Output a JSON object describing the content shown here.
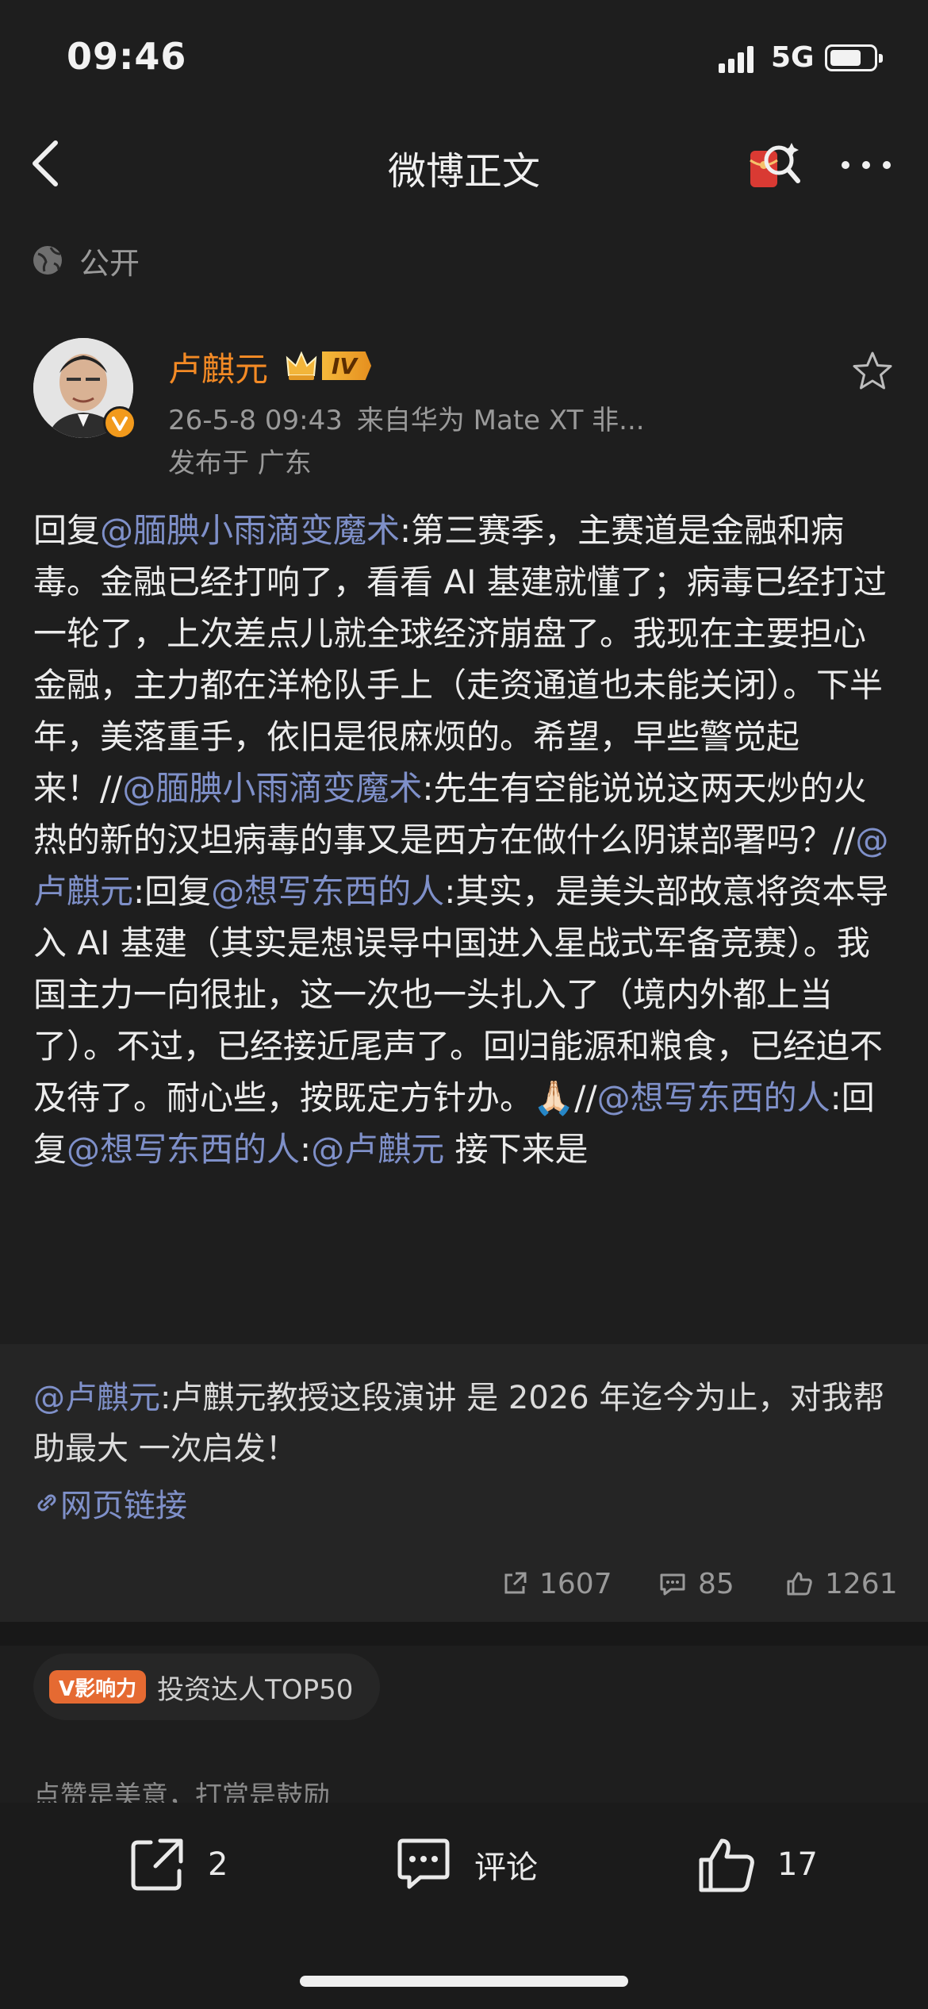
{
  "status_bar": {
    "time": "09:46",
    "network": "5G"
  },
  "nav": {
    "title": "微博正文"
  },
  "visibility": {
    "label": "公开"
  },
  "post": {
    "author": "卢麒元",
    "level_badge": "IV",
    "timestamp": "26-5-8 09:43",
    "source": "来自华为 Mate XT 非...",
    "location": "发布于 广东",
    "body": [
      {
        "t": "回复"
      },
      {
        "t": "@腼腆小雨滴变魔术",
        "m": true
      },
      {
        "t": ":第三赛季，主赛道是金融和病毒。金融已经打响了，看看 AI 基建就懂了；病毒已经打过一轮了，上次差点儿就全球经济崩盘了。我现在主要担心金融，主力都在洋枪队手上（走资通道也未能关闭）。下半年，美落重手，依旧是很麻烦的。希望，早些警觉起来！//"
      },
      {
        "t": "@腼腆小雨滴变魔术",
        "m": true
      },
      {
        "t": ":先生有空能说说这两天炒的火热的新的汉坦病毒的事又是西方在做什么阴谋部署吗？//"
      },
      {
        "t": "@卢麒元",
        "m": true
      },
      {
        "t": ":回复"
      },
      {
        "t": "@想写东西的人",
        "m": true
      },
      {
        "t": ":其实，是美头部故意将资本导入 AI 基建（其实是想误导中国进入星战式军备竞赛）。我国主力一向很扯，这一次也一头扎入了（境内外都上当了）。不过，已经接近尾声了。回归能源和粮食，已经迫不及待了。耐心些，按既定方针办。🙏🏻//"
      },
      {
        "t": "@想写东西的人",
        "m": true
      },
      {
        "t": ":回复"
      },
      {
        "t": "@想写东西的人",
        "m": true
      },
      {
        "t": ":"
      },
      {
        "t": "@卢麒元",
        "m": true
      },
      {
        "t": " 接下来是"
      }
    ]
  },
  "repost": {
    "mention": "@卢麒元",
    "text": ":卢麒元教授这段演讲 是 2026 年迄今为止，对我帮助最大 一次启发！",
    "link_label": "网页链接"
  },
  "stats": {
    "shares": "1607",
    "comments": "85",
    "likes": "1261"
  },
  "influence": {
    "tag": "V影响力",
    "label": "投资达人TOP50"
  },
  "like_hint": "点赞是美意，打赏是鼓励",
  "bottom_bar": {
    "share_count": "2",
    "comment_label": "评论",
    "like_count": "17"
  },
  "colors": {
    "background": "#1e1e1e",
    "mention": "#7f90c9",
    "username": "#f38a25"
  }
}
